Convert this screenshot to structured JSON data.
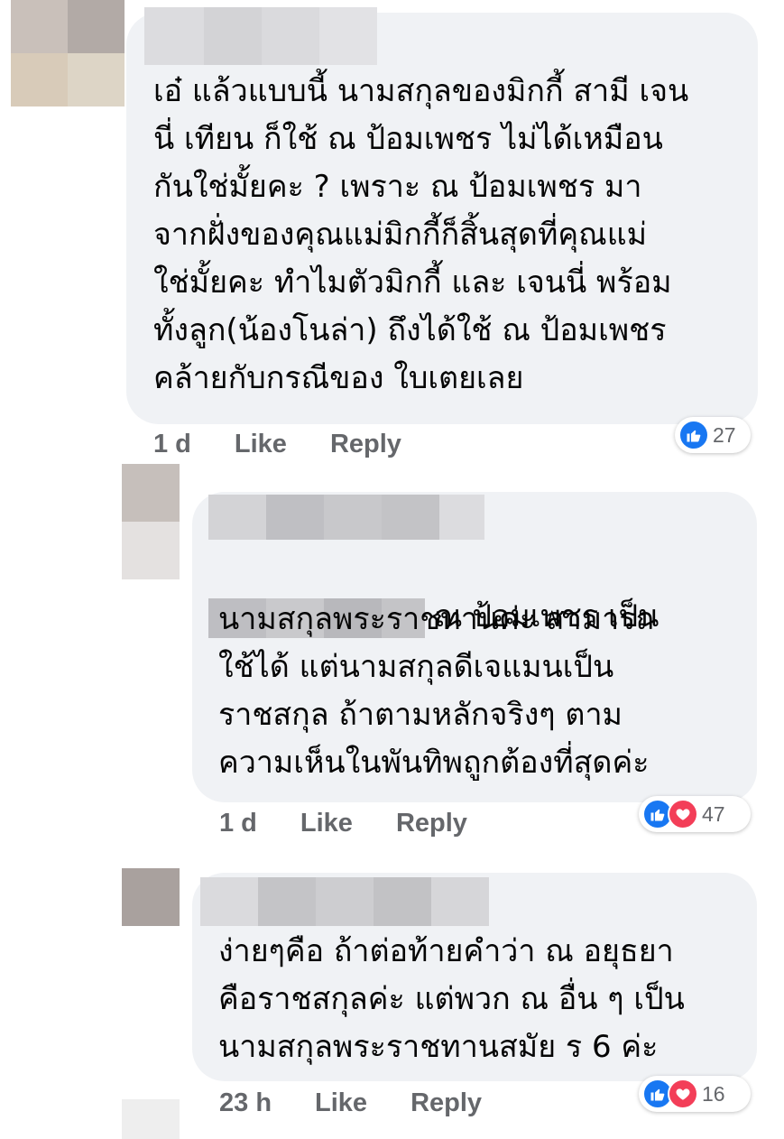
{
  "comments": [
    {
      "text": "เอ๋ แล้วแบบนี้ นามสกุลของมิกกี้ สามี เจน\nนี่ เทียน ก็ใช้ ณ ป้อมเพชร ไม่ได้เหมือน\nกันใช่มั้ยคะ ? เพราะ ณ ป้อมเพชร มา\nจากฝั่งของคุณแม่มิกกี้ก็สิ้นสุดที่คุณแม่\nใช่มั้ยคะ ทำไมตัวมิกกี้ และ เจนนี่ พร้อม\nทั้งลูก(น้องโนล่า) ถึงได้ใช้ ณ ป้อมเพชร\nคล้ายกับกรณีของ ใบเตยเลย",
      "time": "1 d",
      "like_label": "Like",
      "reply_label": "Reply",
      "reaction_count": "27",
      "reactions": [
        "like-icon"
      ]
    },
    {
      "text_after_mention": "ณ ป้อมเพชร เป็น",
      "text": "นามสกุลพระราชทานค่ะ สามารถ\nใช้ได้ แต่นามสกุลดีเจแมนเป็น\nราชสกุล ถ้าตามหลักจริงๆ ตาม\nความเห็นในพันทิพถูกต้องที่สุดค่ะ",
      "time": "1 d",
      "like_label": "Like",
      "reply_label": "Reply",
      "reaction_count": "47",
      "reactions": [
        "like-icon",
        "love-icon"
      ]
    },
    {
      "text": "ง่ายๆคือ ถ้าต่อท้ายคำว่า ณ อยุธยา\nคือราชสกุลค่ะ แต่พวก ณ อื่น ๆ เป็น\nนามสกุลพระราชทานสมัย ร 6 ค่ะ",
      "time": "23 h",
      "like_label": "Like",
      "reply_label": "Reply",
      "reaction_count": "16",
      "reactions": [
        "like-icon",
        "love-icon"
      ]
    }
  ],
  "colors": {
    "bubble": "#f0f2f5",
    "action_text": "#65676b",
    "like_blue": "#1877f2",
    "love_red": "#f33e58"
  }
}
